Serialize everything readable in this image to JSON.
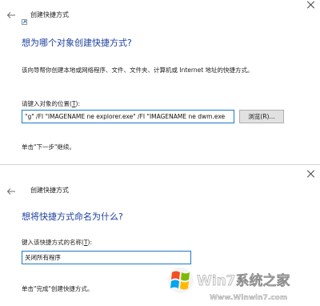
{
  "wizard1": {
    "window_title": "创建快捷方式",
    "heading": "想为哪个对象创建快捷方式?",
    "description": "该向导帮你创建本地或网络程序、文件、文件夹、计算机或 Internet 地址的快捷方式。",
    "field_label_prefix": "请键入对象的位置(",
    "field_label_key": "T",
    "field_label_suffix": "):",
    "location_value": "\"g\" /FI \"IMAGENAME ne explorer.exe\" /FI \"IMAGENAME ne dwm.exe",
    "browse_label": "浏览(R)...",
    "hint": "单击\"下一步\"继续。"
  },
  "wizard2": {
    "window_title": "创建快捷方式",
    "heading": "想将快捷方式命名为什么?",
    "field_label_prefix": "键入该快捷方式的名称(",
    "field_label_key": "T",
    "field_label_suffix": "):",
    "name_value": "关闭所有程序",
    "hint": "单击\"完成\"创建快捷方式。"
  },
  "watermark": {
    "brand": "Win7系统之家",
    "url": "Www.Winwin7.com"
  },
  "colors": {
    "heading": "#1b3f9e",
    "input_border": "#1c78c9"
  }
}
